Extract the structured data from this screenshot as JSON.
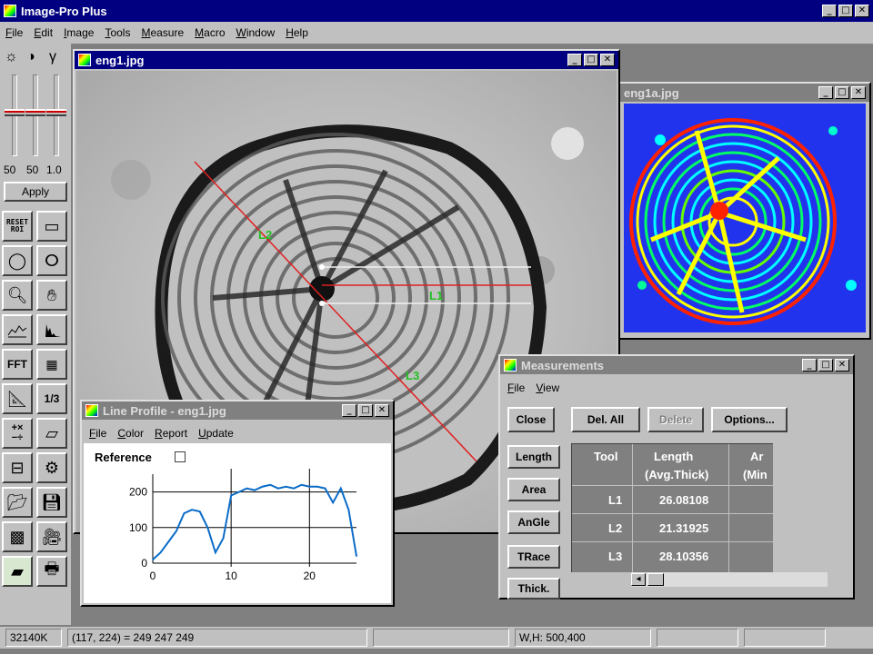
{
  "app": {
    "title": "Image-Pro Plus"
  },
  "menu": [
    "File",
    "Edit",
    "Image",
    "Tools",
    "Measure",
    "Macro",
    "Window",
    "Help"
  ],
  "adjust": {
    "values": [
      "50",
      "50",
      "1.0"
    ],
    "apply_label": "Apply"
  },
  "tools": {
    "reset_label": "RESET\nROI",
    "icons": [
      "rect-select-icon",
      "ellipse-select-icon",
      "freehand-select-icon",
      "zoom-icon",
      "hand-pan-icon",
      "line-profile-icon",
      "histogram-icon",
      "fft-icon",
      "filter-grid-icon",
      "measure-icon",
      "calibrate-icon",
      "arithmetic-icon",
      "layers-icon",
      "flowchart-icon",
      "gears-icon",
      "open-folder-icon",
      "save-disk-icon",
      "grid-icon",
      "camera-icon",
      "print-icon",
      "printer-icon"
    ],
    "fft_label": "FFT",
    "math_label": "+×\n−÷",
    "fraction_label": "1/3"
  },
  "eng1": {
    "title": "eng1.jpg",
    "labels": {
      "l1": "L1",
      "l2": "L2",
      "l3": "L3"
    }
  },
  "eng1a": {
    "title": "eng1a.jpg"
  },
  "line_profile": {
    "title": "Line Profile - eng1.jpg",
    "menu": [
      "File",
      "Color",
      "Report",
      "Update"
    ],
    "reference_label": "Reference",
    "y_ticks": [
      "200",
      "100",
      "0"
    ],
    "x_ticks": [
      "0",
      "10",
      "20"
    ]
  },
  "chart_data": {
    "type": "line",
    "x": [
      0,
      1,
      2,
      3,
      4,
      5,
      6,
      7,
      8,
      9,
      10,
      11,
      12,
      13,
      14,
      15,
      16,
      17,
      18,
      19,
      20,
      21,
      22,
      23,
      24,
      25,
      26
    ],
    "values": [
      10,
      30,
      60,
      90,
      140,
      150,
      145,
      100,
      30,
      70,
      190,
      200,
      210,
      205,
      215,
      220,
      210,
      215,
      210,
      220,
      215,
      215,
      210,
      170,
      210,
      150,
      20
    ],
    "xlim": [
      0,
      26
    ],
    "ylim": [
      0,
      250
    ],
    "grid": true,
    "line_color": "#0b6cc8"
  },
  "measurements": {
    "title": "Measurements",
    "menu": [
      "File",
      "View"
    ],
    "buttons": {
      "close": "Close",
      "del_all": "Del. All",
      "delete": "Delete",
      "options": "Options..."
    },
    "side_buttons": [
      "Length",
      "Area",
      "AnGle",
      "TRace",
      "Thick."
    ],
    "columns": [
      "Tool",
      "Length",
      "(Avg.Thick)",
      "Ar",
      "(Min"
    ],
    "rows": [
      {
        "tool": "L1",
        "length": "26.08108"
      },
      {
        "tool": "L2",
        "length": "21.31925"
      },
      {
        "tool": "L3",
        "length": "28.10356"
      }
    ]
  },
  "status": {
    "memory": "32140K",
    "pixel": "(117, 224) = 249 247 249",
    "size": "W,H: 500,400"
  }
}
